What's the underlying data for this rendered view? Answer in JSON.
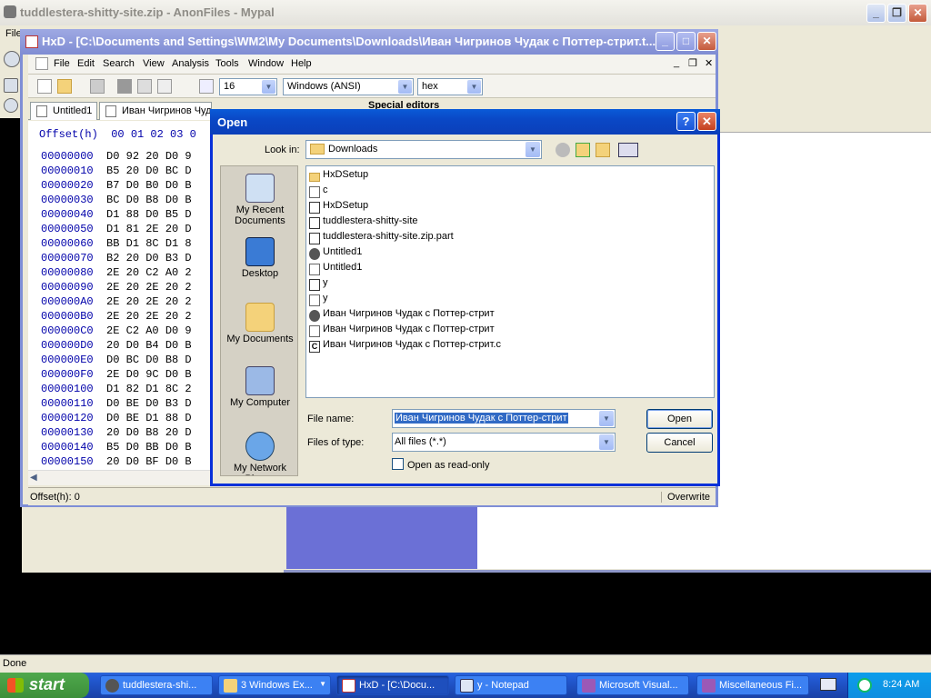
{
  "browser": {
    "title": "tuddlestera-shitty-site.zip - AnonFiles - Mypal",
    "menu_file": "File",
    "status": "Done"
  },
  "hxd": {
    "title": "HxD - [C:\\Documents and Settings\\WM2\\My Documents\\Downloads\\Иван Чигринов Чудак с Поттер-стрит.t...",
    "menu": [
      "File",
      "Edit",
      "Search",
      "View",
      "Analysis",
      "Tools",
      "Window",
      "Help"
    ],
    "toolbar": {
      "bytes_per_row": "16",
      "charset": "Windows (ANSI)",
      "offset_base": "hex"
    },
    "tabs": [
      "Untitled1",
      "Иван Чигринов Чуда"
    ],
    "special_editors": "Special editors",
    "hex_header": "Offset(h)  00 01 02 03 0",
    "rows": [
      {
        "off": "00000000",
        "b": "D0 92 20 D0 9"
      },
      {
        "off": "00000010",
        "b": "B5 20 D0 BC D"
      },
      {
        "off": "00000020",
        "b": "B7 D0 B0 D0 B"
      },
      {
        "off": "00000030",
        "b": "BC D0 B8 D0 B"
      },
      {
        "off": "00000040",
        "b": "D1 88 D0 B5 D"
      },
      {
        "off": "00000050",
        "b": "D1 81 2E 20 D"
      },
      {
        "off": "00000060",
        "b": "BB D1 8C D1 8"
      },
      {
        "off": "00000070",
        "b": "B2 20 D0 B3 D"
      },
      {
        "off": "00000080",
        "b": "2E 20 C2 A0 2"
      },
      {
        "off": "00000090",
        "b": "2E 20 2E 20 2"
      },
      {
        "off": "000000A0",
        "b": "2E 20 2E 20 2"
      },
      {
        "off": "000000B0",
        "b": "2E 20 2E 20 2"
      },
      {
        "off": "000000C0",
        "b": "2E C2 A0 D0 9"
      },
      {
        "off": "000000D0",
        "b": "20 D0 B4 D0 B"
      },
      {
        "off": "000000E0",
        "b": "D0 BC D0 B8 D"
      },
      {
        "off": "000000F0",
        "b": "2E D0 9C D0 B"
      },
      {
        "off": "00000100",
        "b": "D1 82 D1 8C 2"
      },
      {
        "off": "00000110",
        "b": "D0 BE D0 B3 D"
      },
      {
        "off": "00000120",
        "b": "D0 BE D1 88 D"
      },
      {
        "off": "00000130",
        "b": "20 D0 B8 20 D"
      },
      {
        "off": "00000140",
        "b": "B5 D0 BB D0 B"
      },
      {
        "off": "00000150",
        "b": "20 D0 BF D0 B"
      }
    ],
    "status_offset": "Offset(h): 0",
    "status_mode": "Overwrite"
  },
  "dialog": {
    "title": "Open",
    "look_in_label": "Look in:",
    "look_in_value": "Downloads",
    "places": [
      "My Recent Documents",
      "Desktop",
      "My Documents",
      "My Computer",
      "My Network Places"
    ],
    "files": [
      {
        "name": "HxDSetup",
        "icon": "folder-icon"
      },
      {
        "name": "c",
        "icon": "text-file-icon"
      },
      {
        "name": "HxDSetup",
        "icon": "hxd-setup-icon"
      },
      {
        "name": "tuddlestera-shitty-site",
        "icon": "hxd-setup-icon"
      },
      {
        "name": "tuddlestera-shitty-site.zip.part",
        "icon": "hxd-file-icon"
      },
      {
        "name": "Untitled1",
        "icon": "mypal-icon"
      },
      {
        "name": "Untitled1",
        "icon": "text-file-icon"
      },
      {
        "name": "y",
        "icon": "hxd-file-icon"
      },
      {
        "name": "y",
        "icon": "text-file-icon"
      },
      {
        "name": "Иван Чигринов Чудак с Поттер-стрит",
        "icon": "mypal-icon"
      },
      {
        "name": "Иван Чигринов Чудак с Поттер-стрит",
        "icon": "text-file-icon"
      },
      {
        "name": "Иван Чигринов Чудак с Поттер-стрит.c",
        "icon": "c-file-icon"
      }
    ],
    "file_name_label": "File name:",
    "file_name_value": "Иван Чигринов Чудак с Поттер-стрит",
    "files_of_type_label": "Files of type:",
    "files_of_type_value": "All files (*.*)",
    "open_button": "Open",
    "cancel_button": "Cancel",
    "readonly_label": "Open as read-only"
  },
  "taskbar": {
    "start": "start",
    "tasks": [
      {
        "label": "tuddlestera-shi...",
        "icon": "mypal-icon"
      },
      {
        "label": "3 Windows Ex...",
        "icon": "folder-icon"
      },
      {
        "label": "HxD - [C:\\Docu...",
        "icon": "hxd-icon"
      },
      {
        "label": "y - Notepad",
        "icon": "notepad-icon"
      },
      {
        "label": "Microsoft Visual...",
        "icon": "visual-studio-icon"
      },
      {
        "label": "Miscellaneous Fi...",
        "icon": "visual-studio-icon"
      }
    ],
    "clock": "8:24 AM"
  }
}
